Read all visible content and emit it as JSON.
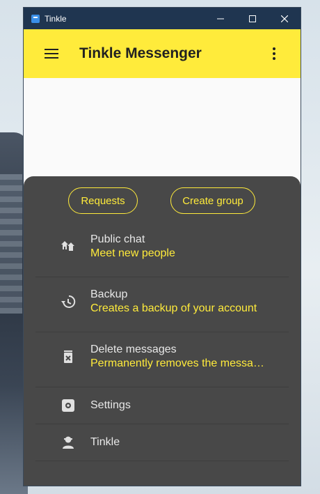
{
  "window": {
    "title": "Tinkle"
  },
  "appbar": {
    "title": "Tinkle Messenger"
  },
  "sheet": {
    "chips": [
      {
        "label": "Requests"
      },
      {
        "label": "Create group"
      }
    ],
    "items": [
      {
        "title": "Public chat",
        "subtitle": "Meet new people",
        "icon": "public-chat-icon"
      },
      {
        "title": "Backup",
        "subtitle": "Creates a backup of your account",
        "icon": "backup-icon"
      },
      {
        "title": "Delete messages",
        "subtitle": "Permanently removes the messages",
        "icon": "delete-icon"
      },
      {
        "title": "Settings",
        "icon": "settings-icon"
      },
      {
        "title": "Tinkle",
        "icon": "person-icon"
      }
    ]
  },
  "colors": {
    "accent": "#ffeb3b",
    "titlebar": "#1f3550",
    "sheet": "#484848"
  }
}
